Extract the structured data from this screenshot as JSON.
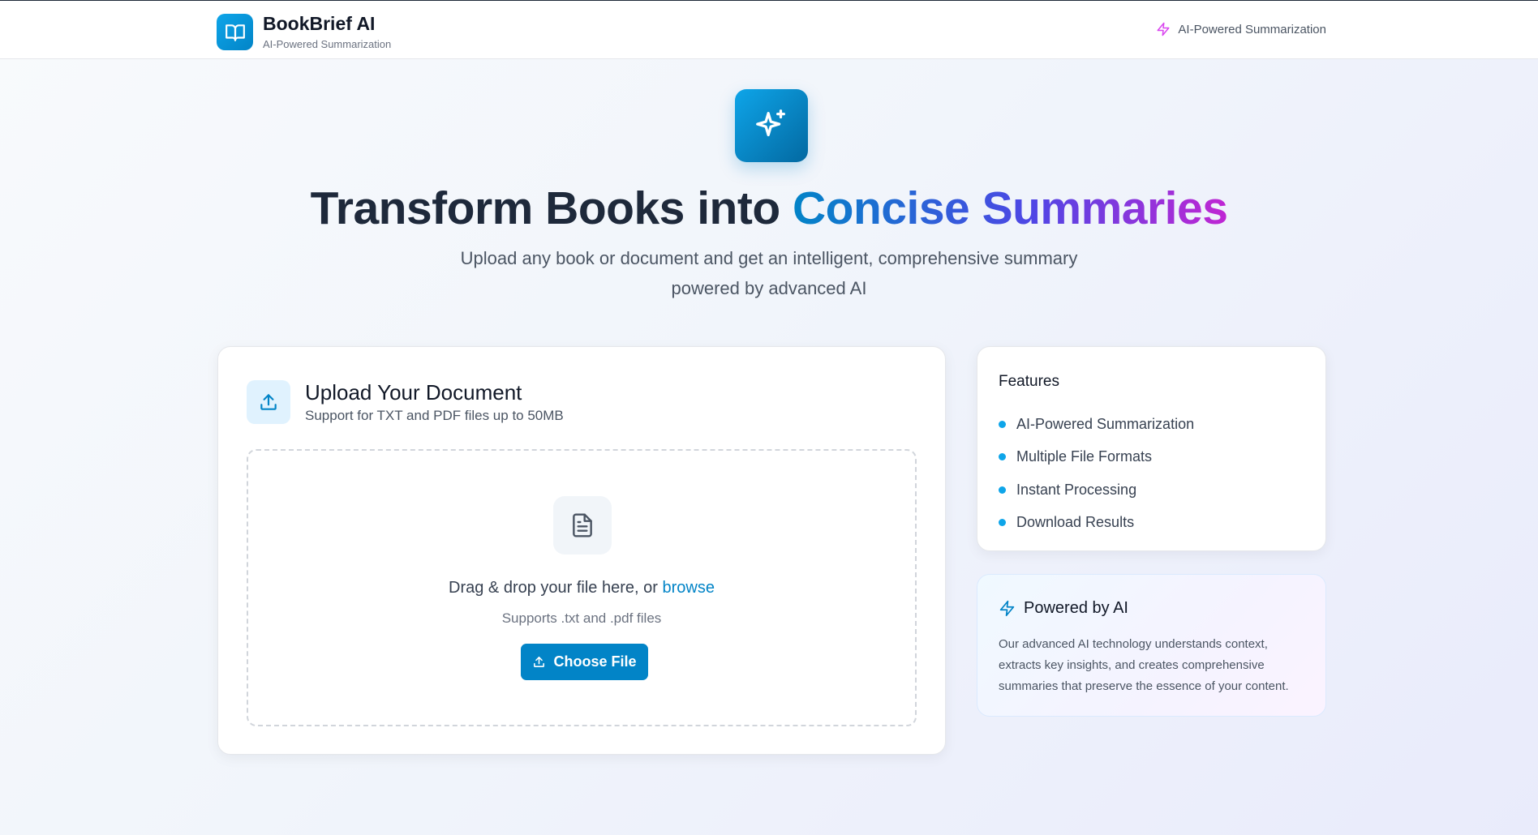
{
  "header": {
    "brand_name": "BookBrief AI",
    "brand_tagline": "AI-Powered Summarization",
    "right_badge": "AI-Powered Summarization",
    "logo_icon": "book-open-icon",
    "badge_icon": "lightning-icon"
  },
  "hero": {
    "icon": "sparkles-icon",
    "title_plain": "Transform Books into ",
    "title_highlight": "Concise Summaries",
    "subtitle_line1": "Upload any book or document and get an intelligent, comprehensive summary",
    "subtitle_line2": "powered by advanced AI"
  },
  "upload": {
    "title": "Upload Your Document",
    "subtitle": "Support for TXT and PDF files up to 50MB",
    "drop_text": "Drag & drop your file here, or ",
    "browse_label": "browse",
    "hint": "Supports .txt and .pdf files",
    "button_label": "Choose File"
  },
  "features": {
    "title": "Features",
    "items": [
      "AI-Powered Summarization",
      "Multiple File Formats",
      "Instant Processing",
      "Download Results"
    ]
  },
  "powered": {
    "title": "Powered by AI",
    "text": "Our advanced AI technology understands context, extracts key insights, and creates comprehensive summaries that preserve the essence of your content."
  },
  "colors": {
    "accent": "#0284c7",
    "gradient_start": "#0284c7",
    "gradient_mid": "#4f46e5",
    "gradient_end": "#c026d3"
  }
}
